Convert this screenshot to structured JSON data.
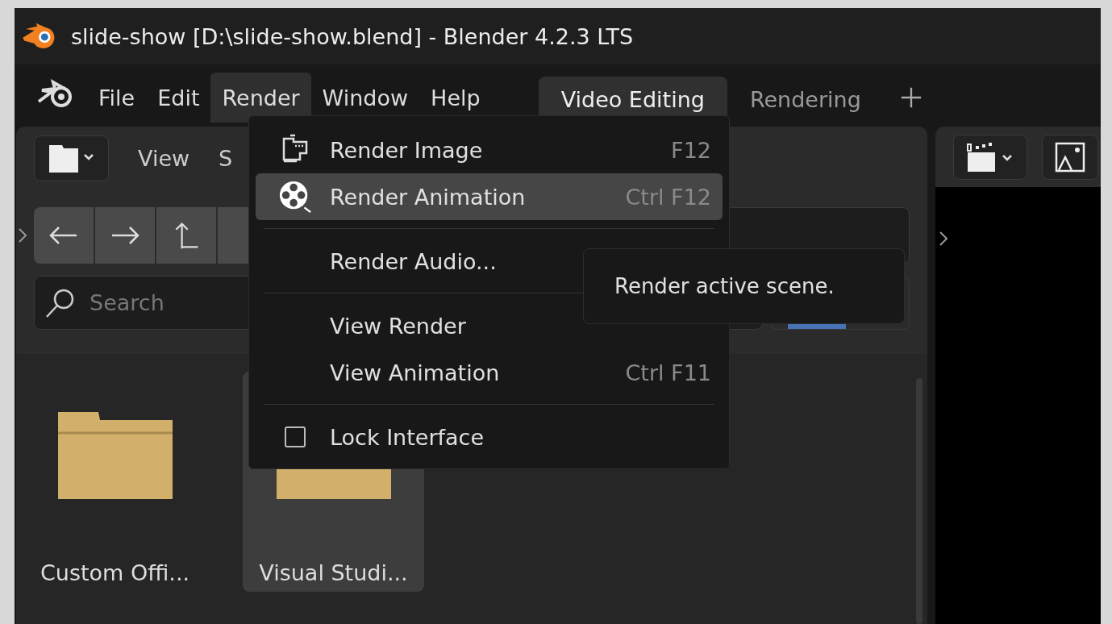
{
  "window": {
    "title": "slide-show [D:\\slide-show.blend] - Blender 4.2.3 LTS"
  },
  "menubar": [
    {
      "label": "File",
      "selected": false
    },
    {
      "label": "Edit",
      "selected": false
    },
    {
      "label": "Render",
      "selected": true
    },
    {
      "label": "Window",
      "selected": false
    },
    {
      "label": "Help",
      "selected": false
    }
  ],
  "workspace_tabs": [
    {
      "label": "Video Editing",
      "selected": true
    },
    {
      "label": "Rendering",
      "selected": false
    }
  ],
  "file_browser": {
    "header_menus": [
      "View",
      "S"
    ],
    "search": {
      "placeholder": "Search"
    },
    "filter_on": true,
    "files": [
      {
        "name": "Custom Offi...",
        "selected": false
      },
      {
        "name": "Visual Studi...",
        "selected": true
      }
    ]
  },
  "render_menu": [
    {
      "kind": "still",
      "label": "Render Image",
      "shortcut": "F12",
      "highlighted": false
    },
    {
      "kind": "movie",
      "label": "Render Animation",
      "shortcut": "Ctrl F12",
      "highlighted": true
    },
    {
      "kind": "separator"
    },
    {
      "kind": "plain",
      "label": "Render Audio...",
      "highlighted": false
    },
    {
      "kind": "separator"
    },
    {
      "kind": "plain",
      "label": "View Render",
      "highlighted": false
    },
    {
      "kind": "plain",
      "label": "View Animation",
      "shortcut": "Ctrl F11",
      "highlighted": false
    },
    {
      "kind": "separator"
    },
    {
      "kind": "checkbox",
      "label": "Lock Interface",
      "checked": false,
      "highlighted": false
    }
  ],
  "tooltip": {
    "text": "Render active scene."
  }
}
